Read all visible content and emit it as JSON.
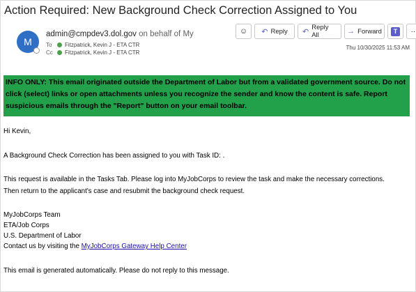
{
  "email": {
    "subject": "Action Required: New Background Check Correction Assigned to You",
    "avatar_initial": "M",
    "sender_address": "admin@cmpdev3.dol.gov",
    "sender_on_behalf": "on behalf of My",
    "to_label": "To",
    "to_name": "Fitzpatrick, Kevin J - ETA  CTR",
    "cc_label": "Cc",
    "cc_name": "Fitzpatrick, Kevin J - ETA  CTR",
    "date": "Thu 10/30/2025 11:53 AM"
  },
  "toolbar": {
    "reply_label": "Reply",
    "reply_all_label": "Reply All",
    "forward_label": "Forward",
    "more_label": "···"
  },
  "banner": {
    "text": "INFO ONLY: This email originated outside the Department of Labor but from a validated government source. Do not click (select) links or open attachments unless you recognize the sender and know the content is safe. Report suspicious emails through the \"Report\" button on your email toolbar.",
    "color": "#23a04a"
  },
  "body": {
    "greeting": "Hi Kevin,",
    "line1": "A Background Check Correction has been assigned to you with Task ID: .",
    "line2": "This request is available in the Tasks Tab. Please log into MyJobCorps to review the task and make the necessary corrections.",
    "line3": "Then return to the applicant's case and resubmit the background check request.",
    "sig1": "MyJobCorps Team",
    "sig2": "ETA/Job Corps",
    "sig3": "U.S. Department of Labor",
    "contact_prefix": "Contact us by visiting the ",
    "contact_link": "MyJobCorps Gateway Help Center",
    "footer": "This email is generated automatically. Please do not reply to this message."
  }
}
